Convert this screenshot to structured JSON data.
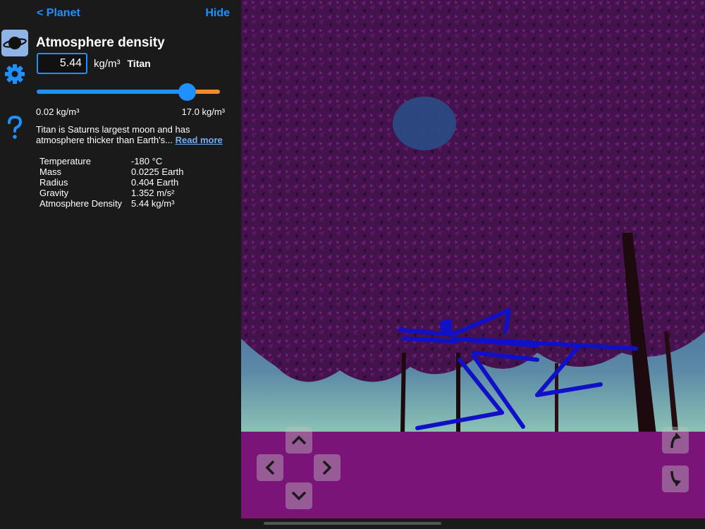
{
  "header": {
    "back_label": "< Planet",
    "hide_label": "Hide"
  },
  "parameter": {
    "title": "Atmosphere density",
    "value": "5.44",
    "unit": "kg/m³",
    "planet": "Titan",
    "slider_fraction": 0.82,
    "min_label": "0.02 kg/m³",
    "max_label": "17.0 kg/m³"
  },
  "description": {
    "text": "Titan is Saturns largest moon and has atmosphere thicker than Earth's...",
    "link": "Read more"
  },
  "properties": [
    {
      "name": "Temperature",
      "value": "-180 °C"
    },
    {
      "name": "Mass",
      "value": "0.0225 Earth"
    },
    {
      "name": "Radius",
      "value": "0.404 Earth"
    },
    {
      "name": "Gravity",
      "value": "1.352 m/s²"
    },
    {
      "name": "Atmosphere Density",
      "value": "5.44 kg/m³"
    }
  ],
  "sidebar": {
    "items": [
      {
        "icon": "planet-icon",
        "active": true
      },
      {
        "icon": "gear-icon",
        "active": false
      },
      {
        "icon": "help-icon",
        "active": false
      }
    ]
  },
  "colors": {
    "accent": "#1e90ff",
    "slider_rest": "#f28a2e",
    "ground": "#7a1478",
    "foliage": "#4a1450",
    "creature": "#1010c8"
  }
}
